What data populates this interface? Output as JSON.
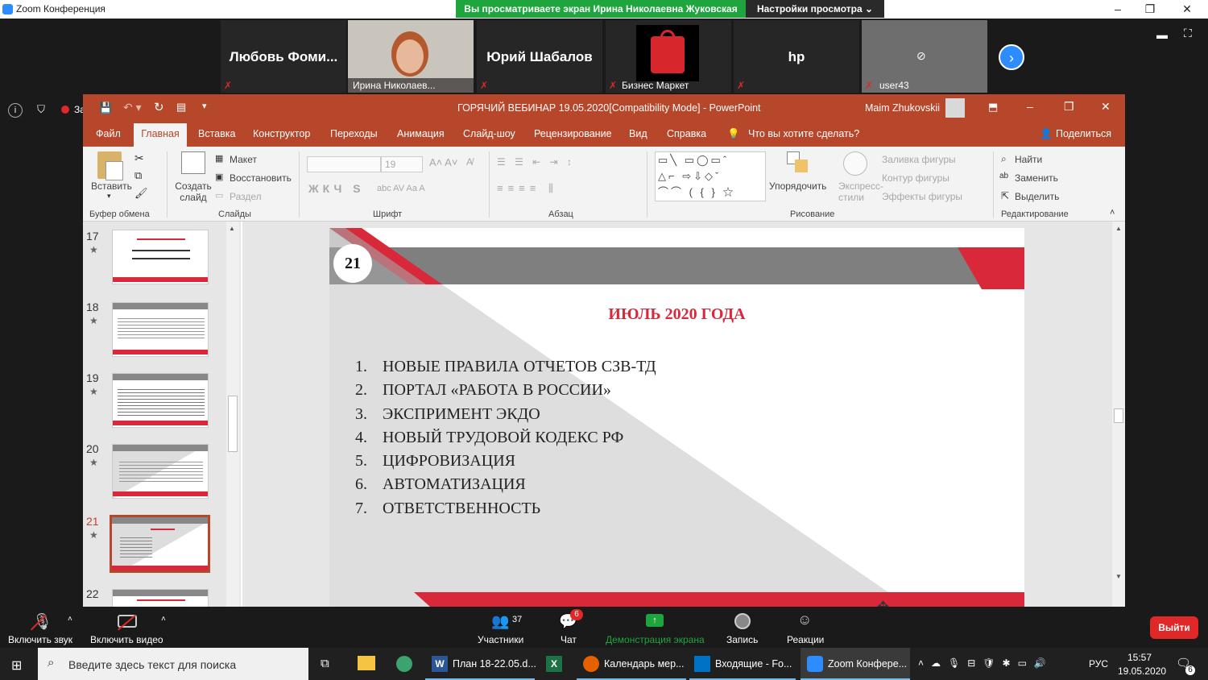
{
  "zoom": {
    "window_title": "Zoom Конференция",
    "share_banner": "Вы просматриваете экран Ирина Николаевна Жуковская",
    "view_options": "Настройки просмотра ⌄",
    "participants": [
      {
        "name": "Любовь Фоми...",
        "big": true
      },
      {
        "name": "Ирина Николаев...",
        "big": false
      },
      {
        "name": "Юрий Шабалов",
        "big": true
      },
      {
        "name": "Бизнес Маркет",
        "big": false
      },
      {
        "name": "hp",
        "big": true
      },
      {
        "name": "user43",
        "big": false
      }
    ],
    "recording_label": "Запись",
    "controls": {
      "mute": "Включить звук",
      "video": "Включить видео",
      "participants": "Участники",
      "participants_count": "37",
      "chat": "Чат",
      "chat_badge": "6",
      "share": "Демонстрация экрана",
      "record": "Запись",
      "reactions": "Реакции",
      "leave": "Выйти"
    }
  },
  "ppt": {
    "title": "ГОРЯЧИЙ ВЕБИНАР 19.05.2020[Compatibility Mode]  -  PowerPoint",
    "user": "Maim Zhukovskii",
    "menu": [
      "Файл",
      "Главная",
      "Вставка",
      "Конструктор",
      "Переходы",
      "Анимация",
      "Слайд-шоу",
      "Рецензирование",
      "Вид",
      "Справка"
    ],
    "tell_me": "Что вы хотите сделать?",
    "share": "Поделиться",
    "ribbon": {
      "paste": "Вставить",
      "clipboard": "Буфер обмена",
      "new_slide": "Создать слайд",
      "layout": "Макет",
      "reset": "Восстановить",
      "section": "Раздел",
      "slides": "Слайды",
      "font_size": "19",
      "font": "Шрифт",
      "paragraph": "Абзац",
      "arrange": "Упорядочить",
      "quick_styles": "Экспресс-стили",
      "shape_fill": "Заливка фигуры",
      "shape_outline": "Контур фигуры",
      "shape_effects": "Эффекты фигуры",
      "drawing": "Рисование",
      "find": "Найти",
      "replace": "Заменить",
      "select": "Выделить",
      "editing": "Редактирование"
    },
    "thumbnails": [
      "17",
      "18",
      "19",
      "20",
      "21",
      "22"
    ],
    "slide": {
      "number": "21",
      "title": "ИЮЛЬ 2020 ГОДА",
      "items": [
        "НОВЫЕ ПРАВИЛА ОТЧЕТОВ СЗВ-ТД",
        "ПОРТАЛ «РАБОТА В РОССИИ»",
        "ЭКСПРИМЕНТ ЭКДО",
        "НОВЫЙ ТРУДОВОЙ КОДЕКС РФ",
        "ЦИФРОВИЗАЦИЯ",
        "АВТОМАТИЗАЦИЯ",
        "ОТВЕТСТВЕННОСТЬ"
      ]
    }
  },
  "taskbar": {
    "search_placeholder": "Введите здесь текст для поиска",
    "apps": [
      {
        "label": "План 18-22.05.d...",
        "active": false
      },
      {
        "label": "Календарь мер...",
        "active": false
      },
      {
        "label": "Входящие - Fo...",
        "active": false
      },
      {
        "label": "Zoom Конфере...",
        "active": true
      }
    ],
    "lang": "РУС",
    "time": "15:57",
    "date": "19.05.2020",
    "notifications": "6"
  },
  "colors": {
    "ppt_accent": "#b7472a",
    "slide_red": "#d9283a",
    "share_green": "#1fa53d",
    "zoom_blue": "#2d8cff"
  }
}
